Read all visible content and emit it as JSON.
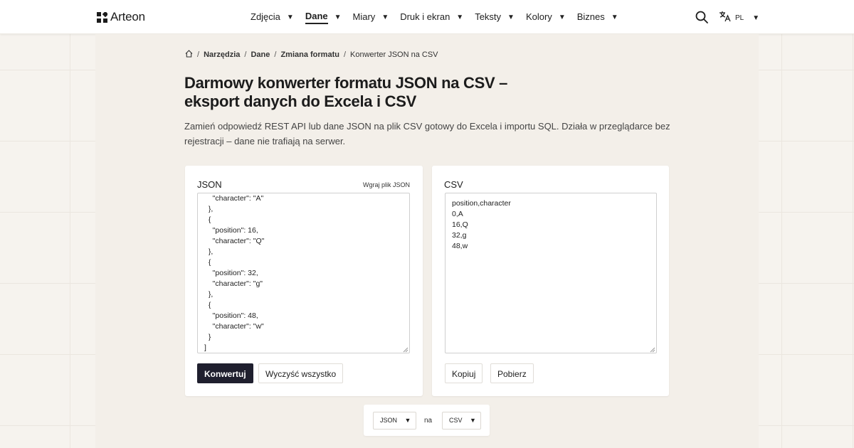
{
  "brand": {
    "name": "Arteon"
  },
  "nav": {
    "items": [
      {
        "label": "Zdjęcia",
        "active": false
      },
      {
        "label": "Dane",
        "active": true
      },
      {
        "label": "Miary",
        "active": false
      },
      {
        "label": "Druk i ekran",
        "active": false
      },
      {
        "label": "Teksty",
        "active": false
      },
      {
        "label": "Kolory",
        "active": false
      },
      {
        "label": "Biznes",
        "active": false
      }
    ],
    "caret": "▼",
    "lang_code": "PL"
  },
  "breadcrumb": {
    "items": [
      "Narzędzia",
      "Dane",
      "Zmiana formatu"
    ],
    "current": "Konwerter JSON na CSV",
    "separator": "/"
  },
  "page": {
    "title": "Darmowy konwerter formatu JSON na CSV – eksport danych do Excela i CSV",
    "lead": "Zamień odpowiedź REST API lub dane JSON na plik CSV gotowy do Excela i importu SQL. Działa w przeglądarce bez rejestracji – dane nie trafiają na serwer."
  },
  "input_panel": {
    "title": "JSON",
    "upload_label": "Wgraj plik JSON",
    "lines": [
      "    \"character\": \"A\"",
      "  },",
      "  {",
      "    \"position\": 16,",
      "    \"character\": \"Q\"",
      "  },",
      "  {",
      "    \"position\": 32,",
      "    \"character\": \"g\"",
      "  },",
      "  {",
      "    \"position\": 48,",
      "    \"character\": \"w\"",
      "  }",
      "]"
    ],
    "convert_label": "Konwertuj",
    "clear_label": "Wyczyść wszystko"
  },
  "output_panel": {
    "title": "CSV",
    "lines": [
      "position,character",
      "0,A",
      "16,Q",
      "32,g",
      "48,w"
    ],
    "copy_label": "Kopiuj",
    "download_label": "Pobierz"
  },
  "format_switch": {
    "from": "JSON",
    "joiner": "na",
    "to": "CSV"
  }
}
